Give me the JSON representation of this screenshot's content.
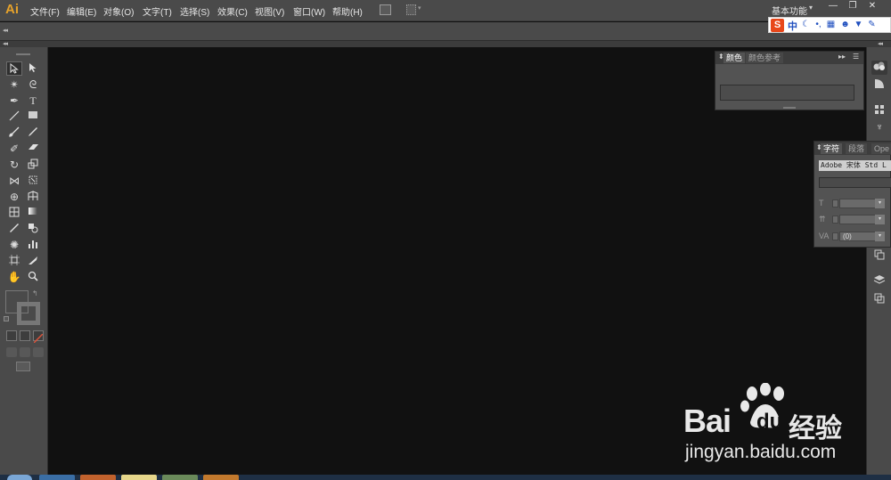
{
  "app": {
    "logo": "Ai"
  },
  "menubar": {
    "items": [
      "文件(F)",
      "编辑(E)",
      "对象(O)",
      "文字(T)",
      "选择(S)",
      "效果(C)",
      "视图(V)",
      "窗口(W)",
      "帮助(H)"
    ],
    "workspace": "基本功能"
  },
  "window_controls": {
    "minimize": "—",
    "restore": "❐",
    "close": "✕"
  },
  "ime": {
    "logo": "S",
    "mode": "中"
  },
  "icons": {
    "tools": [
      "selection-tool-icon",
      "direct-selection-tool-icon",
      "magic-wand-tool-icon",
      "lasso-tool-icon",
      "pen-tool-icon",
      "type-tool-icon",
      "line-segment-tool-icon",
      "rectangle-tool-icon",
      "paintbrush-tool-icon",
      "pencil-tool-icon",
      "blob-brush-tool-icon",
      "eraser-tool-icon",
      "rotate-tool-icon",
      "scale-tool-icon",
      "width-tool-icon",
      "free-transform-tool-icon",
      "shape-builder-tool-icon",
      "perspective-grid-tool-icon",
      "mesh-tool-icon",
      "gradient-tool-icon",
      "eyedropper-tool-icon",
      "blend-tool-icon",
      "symbol-sprayer-tool-icon",
      "column-graph-tool-icon",
      "artboard-tool-icon",
      "slice-tool-icon",
      "hand-tool-icon",
      "zoom-tool-icon"
    ],
    "dock": [
      "color-panel-icon",
      "color-guide-icon",
      "swatches-icon",
      "brushes-icon",
      "transparency-icon",
      "layers-icon",
      "artboards-icon"
    ]
  },
  "color_panel": {
    "tabs": [
      "颜色",
      "颜色参考"
    ],
    "active_tab": "颜色"
  },
  "character_panel": {
    "tabs": [
      "字符",
      "段落",
      "Ope"
    ],
    "active_tab": "字符",
    "font_family": "Adobe 宋体 Std L",
    "font_style": "",
    "tracking_value": "(0)"
  },
  "watermark": {
    "brand": "Bai",
    "brand_tail": "du",
    "cn": "经验",
    "url": "jingyan.baidu.com"
  },
  "colors": {
    "accent": "#e6a22b",
    "panel": "#535353",
    "chrome": "#4a4a4a",
    "canvas": "#111111"
  }
}
